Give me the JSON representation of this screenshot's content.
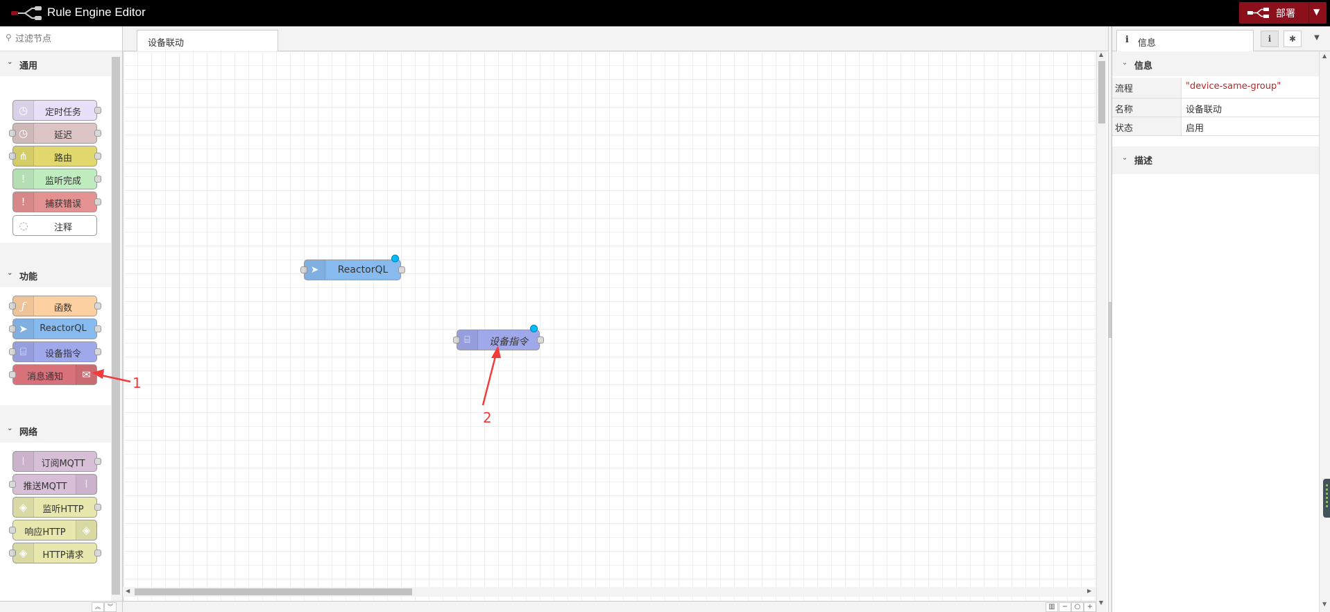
{
  "app": {
    "title": "Rule Engine Editor",
    "deploy_label": "部署",
    "colors": {
      "header_bg": "#000000",
      "deploy_bg": "#8c101c",
      "accent_changed": "#00bcff",
      "annotation": "#f23b3b"
    }
  },
  "palette": {
    "search_placeholder": "过滤节点",
    "categories": [
      {
        "name": "通用",
        "nodes": [
          {
            "label": "定时任务",
            "icon": "timer-icon",
            "color": "#e7e7ae"
          },
          {
            "label": "延迟",
            "icon": "timer-icon",
            "color": "#e6e0f8"
          },
          {
            "label": "路由",
            "icon": "switch-icon",
            "color": "#e2d96e"
          },
          {
            "label": "监听完成",
            "icon": "alert-icon",
            "color": "#c0edc0"
          },
          {
            "label": "捕获错误",
            "icon": "alert-icon",
            "color": "#e49191"
          },
          {
            "label": "注释",
            "icon": "comment-icon",
            "color": "#ffffff"
          }
        ]
      },
      {
        "name": "功能",
        "nodes": [
          {
            "label": "函数",
            "icon": "function-icon",
            "color": "#fdd0a2"
          },
          {
            "label": "ReactorQL",
            "icon": "reactorql-icon",
            "color": "#87a9f0"
          },
          {
            "label": "设备指令",
            "icon": "device-command-icon",
            "color": "#a6bbcf"
          },
          {
            "label": "消息通知",
            "icon": "envelope-icon",
            "color": "#d7727a"
          }
        ]
      },
      {
        "name": "网络",
        "nodes": [
          {
            "label": "订阅MQTT",
            "icon": "mqtt-icon",
            "color": "#d8bfd8"
          },
          {
            "label": "推送MQTT",
            "icon": "mqtt-icon",
            "color": "#d8bfd8"
          },
          {
            "label": "监听HTTP",
            "icon": "http-icon",
            "color": "#e7e7ae"
          },
          {
            "label": "响应HTTP",
            "icon": "http-icon",
            "color": "#e7e7ae"
          },
          {
            "label": "HTTP请求",
            "icon": "http-icon",
            "color": "#e7e7ae"
          }
        ]
      }
    ]
  },
  "workspace": {
    "tab_label": "设备联动",
    "nodes": [
      {
        "label": "ReactorQL",
        "icon": "reactorql-icon"
      },
      {
        "label": "设备指令",
        "icon": "device-command-icon"
      }
    ],
    "annotations": {
      "first": "1",
      "second": "2"
    }
  },
  "sidebar": {
    "tab_label": "信息",
    "info_section": "信息",
    "desc_section": "描述",
    "rows": [
      {
        "key": "流程",
        "value": "\"device-same-group\""
      },
      {
        "key": "名称",
        "value": "设备联动"
      },
      {
        "key": "状态",
        "value": "启用"
      }
    ]
  }
}
